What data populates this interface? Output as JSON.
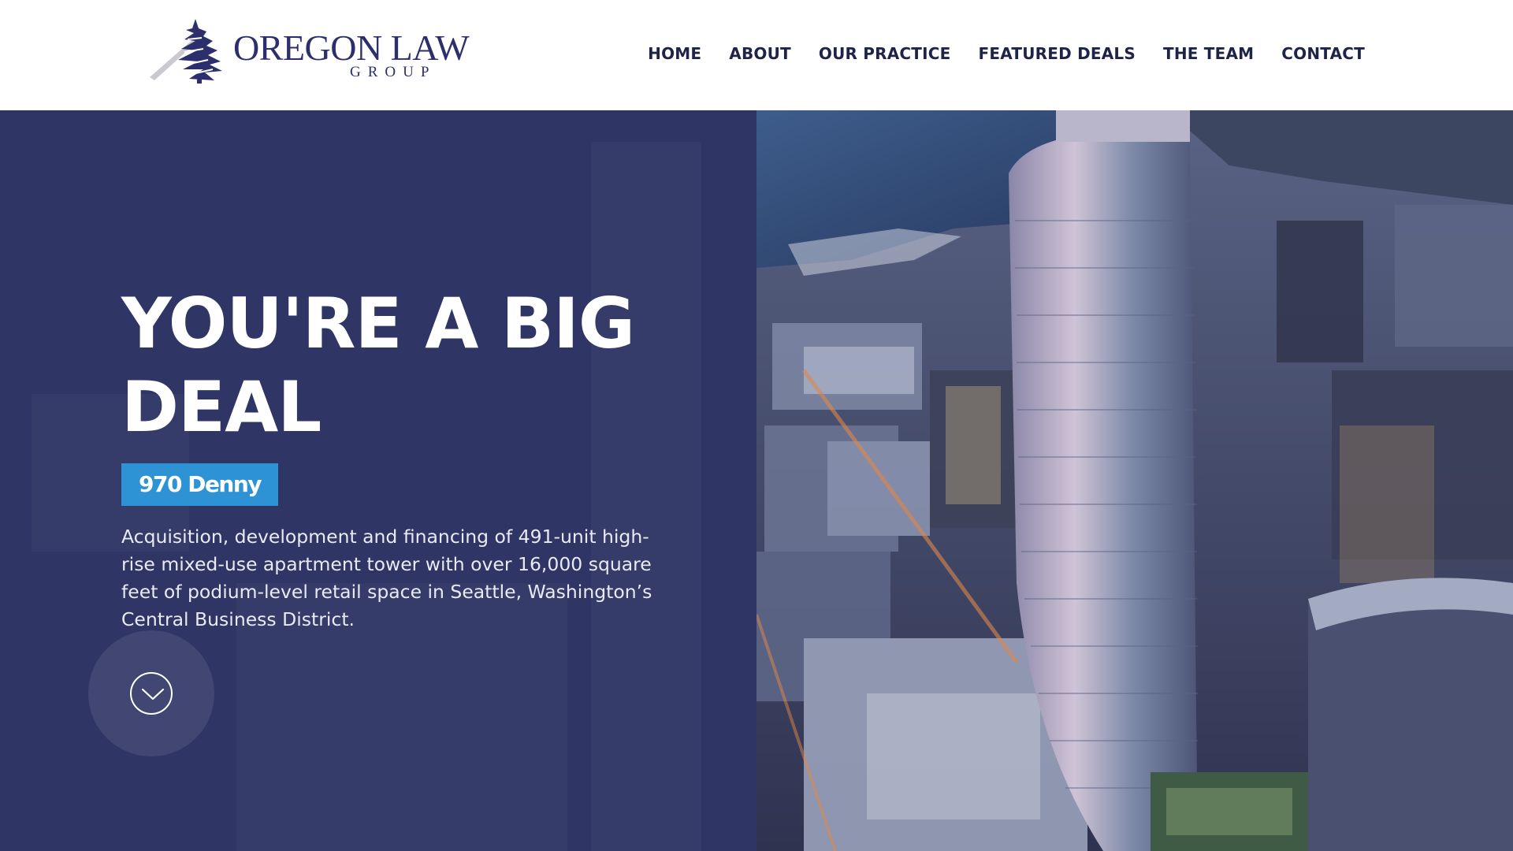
{
  "brand": {
    "name_line1": "OREGON LAW",
    "name_line2": "GROUP",
    "logo_icon": "tree-icon",
    "primary_color": "#2c2f6b"
  },
  "nav": {
    "items": [
      {
        "label": "HOME"
      },
      {
        "label": "ABOUT"
      },
      {
        "label": "OUR PRACTICE"
      },
      {
        "label": "FEATURED DEALS"
      },
      {
        "label": "THE TEAM"
      },
      {
        "label": "CONTACT"
      }
    ]
  },
  "hero": {
    "headline": "YOU'RE A BIG DEAL",
    "deal_name": "970 Denny",
    "deal_description": "Acquisition, development and financing of 491-unit high-rise mixed-use apartment tower with over 16,000 square feet of podium-level retail space in Seattle, Washington’s Central Business District.",
    "scroll_icon": "chevron-down-icon",
    "panel_color": "#2f3564",
    "badge_color": "#2d93d4",
    "image_subject": "aerial rendering of high-rise tower in Seattle"
  }
}
